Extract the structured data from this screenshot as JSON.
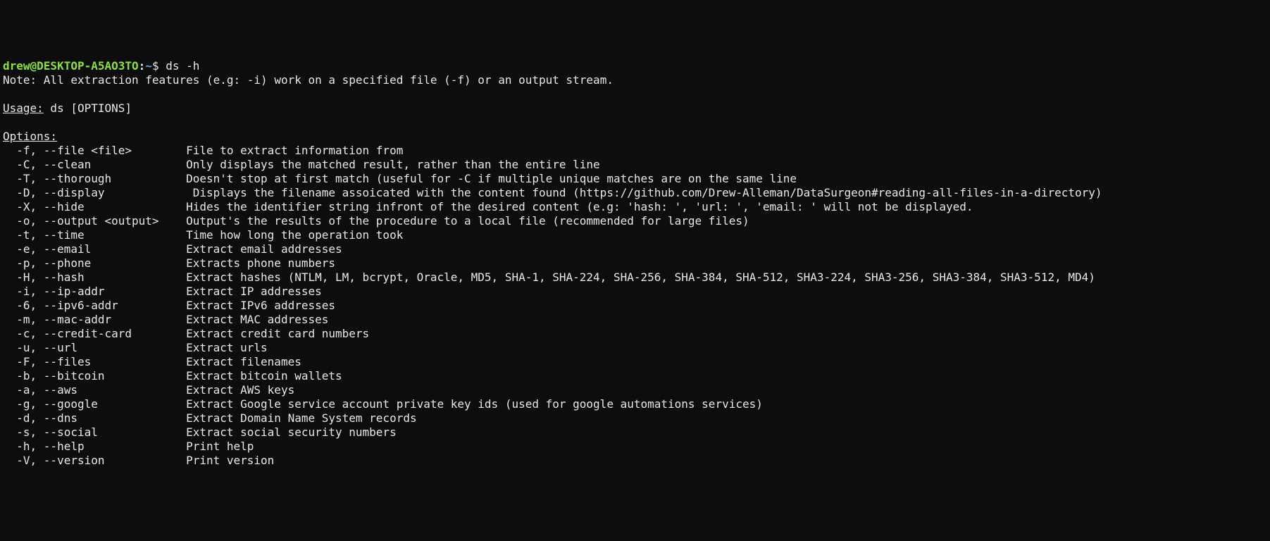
{
  "prompt": {
    "user": "drew@DESKTOP-A5AO3TO",
    "sep": ":",
    "path": "~",
    "dollar": "$ ",
    "command": "ds -h"
  },
  "note": "Note: All extraction features (e.g: -i) work on a specified file (-f) or an output stream.",
  "usage_label": "Usage:",
  "usage_text": " ds [OPTIONS]",
  "options_label": "Options:",
  "options": [
    {
      "flag": "-f, --file <file>",
      "desc": "File to extract information from"
    },
    {
      "flag": "-C, --clean",
      "desc": "Only displays the matched result, rather than the entire line"
    },
    {
      "flag": "-T, --thorough",
      "desc": "Doesn't stop at first match (useful for -C if multiple unique matches are on the same line"
    },
    {
      "flag": "-D, --display",
      "desc": " Displays the filename assoicated with the content found (https://github.com/Drew-Alleman/DataSurgeon#reading-all-files-in-a-directory)"
    },
    {
      "flag": "-X, --hide",
      "desc": "Hides the identifier string infront of the desired content (e.g: 'hash: ', 'url: ', 'email: ' will not be displayed."
    },
    {
      "flag": "-o, --output <output>",
      "desc": "Output's the results of the procedure to a local file (recommended for large files)"
    },
    {
      "flag": "-t, --time",
      "desc": "Time how long the operation took"
    },
    {
      "flag": "-e, --email",
      "desc": "Extract email addresses"
    },
    {
      "flag": "-p, --phone",
      "desc": "Extracts phone numbers"
    },
    {
      "flag": "-H, --hash",
      "desc": "Extract hashes (NTLM, LM, bcrypt, Oracle, MD5, SHA-1, SHA-224, SHA-256, SHA-384, SHA-512, SHA3-224, SHA3-256, SHA3-384, SHA3-512, MD4)"
    },
    {
      "flag": "-i, --ip-addr",
      "desc": "Extract IP addresses"
    },
    {
      "flag": "-6, --ipv6-addr",
      "desc": "Extract IPv6 addresses"
    },
    {
      "flag": "-m, --mac-addr",
      "desc": "Extract MAC addresses"
    },
    {
      "flag": "-c, --credit-card",
      "desc": "Extract credit card numbers"
    },
    {
      "flag": "-u, --url",
      "desc": "Extract urls"
    },
    {
      "flag": "-F, --files",
      "desc": "Extract filenames"
    },
    {
      "flag": "-b, --bitcoin",
      "desc": "Extract bitcoin wallets"
    },
    {
      "flag": "-a, --aws",
      "desc": "Extract AWS keys"
    },
    {
      "flag": "-g, --google",
      "desc": "Extract Google service account private key ids (used for google automations services)"
    },
    {
      "flag": "-d, --dns",
      "desc": "Extract Domain Name System records"
    },
    {
      "flag": "-s, --social",
      "desc": "Extract social security numbers"
    },
    {
      "flag": "-h, --help",
      "desc": "Print help"
    },
    {
      "flag": "-V, --version",
      "desc": "Print version"
    }
  ]
}
